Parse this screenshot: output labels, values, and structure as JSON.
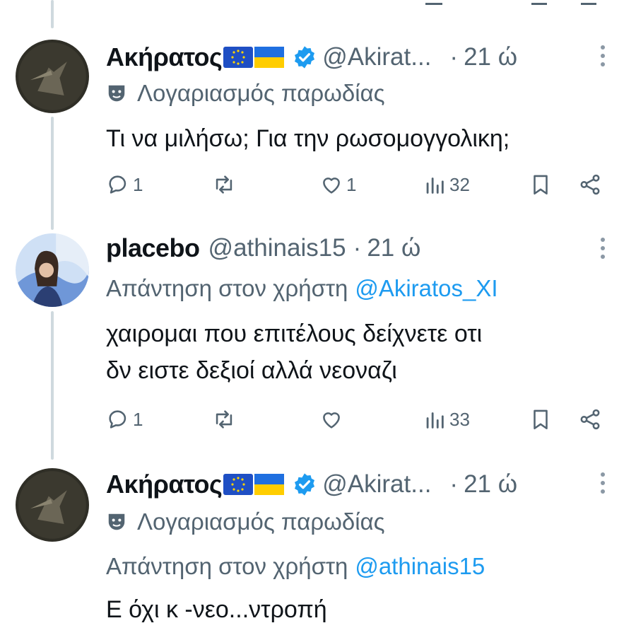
{
  "tweets": [
    {
      "name": "Ακήρατος",
      "handle": "@Akirat...",
      "separator": "·",
      "time": "21 ώ",
      "label": "Λογαριασμός παρωδίας",
      "text_lines": [
        "Τι να μιλήσω; Για την ρωσομογγολικη;"
      ],
      "replies": "1",
      "reposts": "",
      "likes": "1",
      "views": "32"
    },
    {
      "name": "placebo",
      "handle": "@athinais15",
      "separator": "·",
      "time": "21 ώ",
      "reply_prefix": "Απάντηση στον χρήστη",
      "reply_to": "@Akiratos_XI",
      "text_lines": [
        "χαιρομαι που επιτέλους δείχνετε οτι",
        "δν ειστε δεξιοί αλλά νεοναζι"
      ],
      "replies": "1",
      "reposts": "",
      "likes": "",
      "views": "33"
    },
    {
      "name": "Ακήρατος",
      "handle": "@Akirat...",
      "separator": "·",
      "time": "21 ώ",
      "label": "Λογαριασμός παρωδίας",
      "reply_prefix": "Απάντηση στον χρήστη",
      "reply_to": "@athinais15",
      "text_lines": [
        "Ε όχι κ -νεο...ντροπή"
      ]
    }
  ],
  "icons": {
    "verified": "verified-badge-icon",
    "parody": "theater-mask-icon",
    "reply": "speech-bubble-icon",
    "repost": "repost-arrows-icon",
    "like": "heart-icon",
    "views": "bar-chart-icon",
    "bookmark": "bookmark-icon",
    "share": "share-icon",
    "more": "more-vertical-icon"
  },
  "colors": {
    "text": "#0f1419",
    "secondary": "#536471",
    "link": "#1d9bf0",
    "verified": "#1d9bf0"
  }
}
